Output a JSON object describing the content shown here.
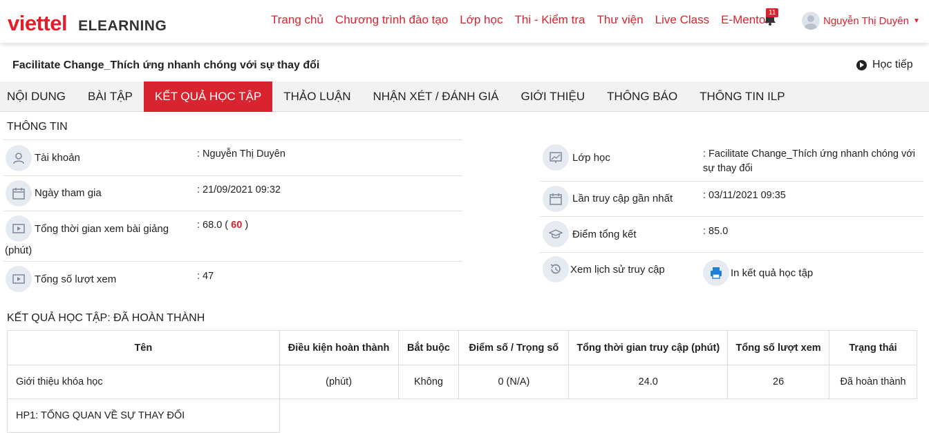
{
  "header": {
    "brand": "viettel",
    "product": "ELEARNING",
    "nav": [
      "Trang chủ",
      "Chương trình đào tạo",
      "Lớp học",
      "Thi - Kiểm tra",
      "Thư viện",
      "Live Class",
      "E-Mentor"
    ],
    "notification_count": "11",
    "user_name": "Nguyễn Thị Duyên"
  },
  "course": {
    "title": "Facilitate Change_Thích ứng nhanh chóng với sự thay đổi",
    "continue_label": "Học tiếp"
  },
  "tabs": [
    "NỘI DUNG",
    "BÀI TẬP",
    "KẾT QUẢ HỌC TẬP",
    "THẢO LUẬN",
    "NHẬN XÉT / ĐÁNH GIÁ",
    "GIỚI THIỆU",
    "THÔNG BÁO",
    "THÔNG TIN ILP"
  ],
  "active_tab": "KẾT QUẢ HỌC TẬP",
  "info": {
    "section_title": "THÔNG TIN",
    "left": [
      {
        "label": "Tài khoản",
        "value": ": Nguyễn Thị Duyên"
      },
      {
        "label": "Ngày tham gia",
        "value": ": 21/09/2021 09:32"
      },
      {
        "label": "Tổng thời gian xem bài giảng",
        "label_cont": "(phút)",
        "value_prefix": ": 68.0 (",
        "value_highlight": "60",
        "value_suffix": ")"
      },
      {
        "label": "Tổng số lượt xem",
        "value": ": 47"
      }
    ],
    "right": [
      {
        "label": "Lớp học",
        "value_line1": ": Facilitate Change_Thích ứng nhanh chóng với",
        "value_line2": "sự thay đổi"
      },
      {
        "label": "Lần truy cập gần nhất",
        "value": ": 03/11/2021 09:35"
      },
      {
        "label": "Điểm tổng kết",
        "value": ": 85.0"
      },
      {
        "label": "Xem lịch sử truy cập",
        "action": "In kết quả học tập"
      }
    ]
  },
  "results": {
    "section_title": "KẾT QUẢ HỌC TẬP: ĐÃ HOÀN THÀNH",
    "columns": [
      "Tên",
      "Điều kiện hoàn thành",
      "Bắt buộc",
      "Điểm số / Trọng số",
      "Tổng thời gian truy cập (phút)",
      "Tổng số lượt xem",
      "Trạng thái"
    ],
    "rows": [
      {
        "name": "Giới thiệu khóa học",
        "condition": "(phút)",
        "required": "Không",
        "score": "0 (N/A)",
        "time": "24.0",
        "views": "26",
        "status": "Đã hoàn thành"
      }
    ],
    "section_row": "HP1: TỔNG QUAN VỀ SỰ THAY ĐỔI"
  },
  "colors": {
    "accent": "#d9232e",
    "tab_bar": "#f2f2f2",
    "icon_bg": "#e6ebf2"
  }
}
